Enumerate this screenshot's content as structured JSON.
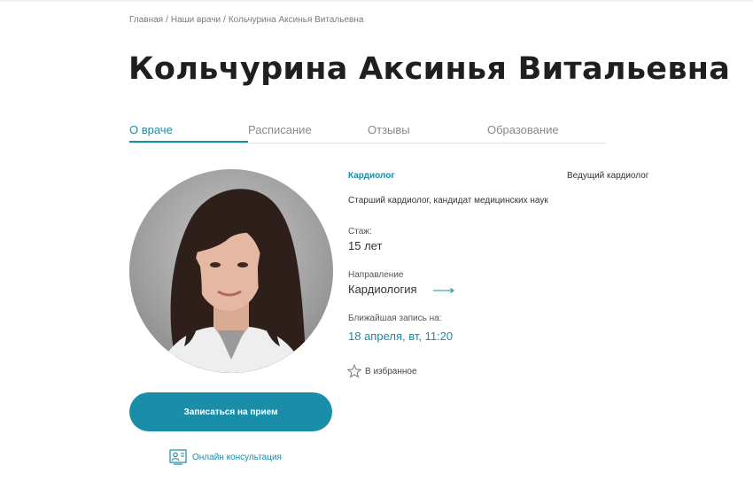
{
  "breadcrumb": {
    "items": [
      "Главная",
      "Наши врачи",
      "Кольчурина Аксинья Витальевна"
    ],
    "separator": "/"
  },
  "doctor": {
    "name": "Кольчурина Аксинья Витальевна",
    "specialty": "Кардиолог",
    "position": "Ведущий кардиолог",
    "degree": "Старший кардиолог, кандидат медицинских наук",
    "experience_label": "Стаж:",
    "experience_value": "15 лет",
    "direction_label": "Направление",
    "direction_value": "Кардиология",
    "next_label": "Ближайшая запись на:",
    "next_value": "18 апреля, вт, 11:20"
  },
  "tabs": [
    {
      "label": "О враче",
      "active": true
    },
    {
      "label": "Расписание",
      "active": false
    },
    {
      "label": "Отзывы",
      "active": false
    },
    {
      "label": "Образование",
      "active": false
    }
  ],
  "actions": {
    "favorite_label": "В избранное",
    "favorite_icon": "star-icon",
    "book_label": "Записаться на прием",
    "online_label": "Онлайн консультация",
    "online_icon": "video-consultation-icon",
    "direction_icon": "arrow-right-icon"
  },
  "colors": {
    "accent": "#1c8ba4",
    "button": "#1a8ea8",
    "title": "#1f1f1f"
  }
}
